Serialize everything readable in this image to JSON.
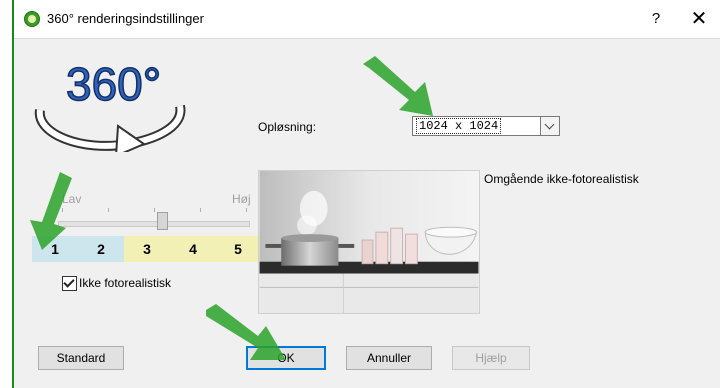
{
  "dialog": {
    "title": "360° renderingsindstillinger",
    "help_glyph": "?",
    "close_glyph": "✕"
  },
  "logo": {
    "text": "360°"
  },
  "resolution": {
    "label": "Opløsning:",
    "value": "1024 x 1024"
  },
  "quality": {
    "low_label": "Lav",
    "high_label": "Høj",
    "levels": [
      "1",
      "2",
      "3",
      "4",
      "5"
    ],
    "selected_level": 3
  },
  "checkbox": {
    "label": "Ikke fotorealistisk",
    "checked": true
  },
  "preview_mode_label": "Omgående ikke-fotorealistisk",
  "buttons": {
    "standard": "Standard",
    "ok": "OK",
    "cancel": "Annuller",
    "help": "Hjælp"
  },
  "colors": {
    "accent_blue": "#0078d7",
    "annotation_green": "#2aa22a",
    "quality_blue": "#cde6ee",
    "quality_yellow": "#f2f0b4"
  },
  "icons": [
    "app-icon",
    "help-icon",
    "close-icon",
    "checkmark-icon",
    "dropdown-caret-icon",
    "annotation-arrow-icon"
  ]
}
